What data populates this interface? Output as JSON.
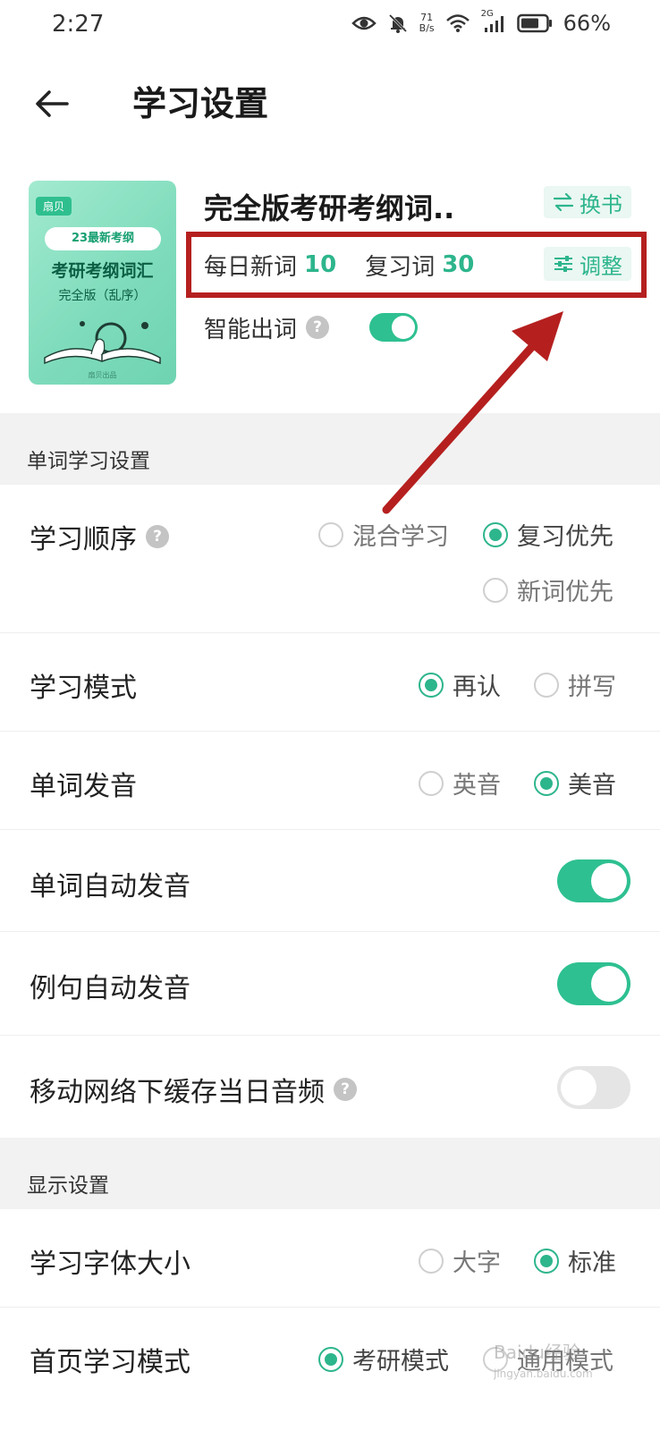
{
  "status_bar": {
    "time": "2:27",
    "net_speed_value": "71",
    "net_speed_unit": "B/s",
    "signal_label": "2G",
    "battery": "66%"
  },
  "header": {
    "title": "学习设置"
  },
  "book": {
    "cover": {
      "brand": "扇贝",
      "badge": "23最新考纲",
      "title": "考研考纲词汇",
      "subtitle": "完全版（乱序）",
      "publisher": "扇贝出品"
    },
    "title": "完全版考研考纲词..",
    "swap_label": "换书",
    "daily_new_label": "每日新词",
    "daily_new_value": "10",
    "review_label": "复习词",
    "review_value": "30",
    "adjust_label": "调整",
    "smart_label": "智能出词",
    "smart_on": true
  },
  "section_word": {
    "title": "单词学习设置",
    "order": {
      "label": "学习顺序",
      "options": [
        "混合学习",
        "复习优先",
        "新词优先"
      ],
      "selected": "复习优先"
    },
    "mode": {
      "label": "学习模式",
      "options": [
        "再认",
        "拼写"
      ],
      "selected": "再认"
    },
    "pronunciation": {
      "label": "单词发音",
      "options": [
        "英音",
        "美音"
      ],
      "selected": "美音"
    },
    "auto_word": {
      "label": "单词自动发音",
      "on": true
    },
    "auto_sentence": {
      "label": "例句自动发音",
      "on": true
    },
    "cache_audio": {
      "label": "移动网络下缓存当日音频",
      "on": false
    }
  },
  "section_display": {
    "title": "显示设置",
    "font_size": {
      "label": "学习字体大小",
      "options": [
        "大字",
        "标准"
      ],
      "selected": "标准"
    },
    "home_mode": {
      "label": "首页学习模式",
      "options": [
        "考研模式",
        "通用模式"
      ],
      "selected": "考研模式"
    }
  },
  "watermark": {
    "text": "Baidu经验",
    "url": "jingyan.baidu.com"
  },
  "colors": {
    "accent": "#2db58c",
    "toggle_on": "#2ec091",
    "annotation_red": "#b5201f",
    "section_bg": "#f2f2f2"
  }
}
